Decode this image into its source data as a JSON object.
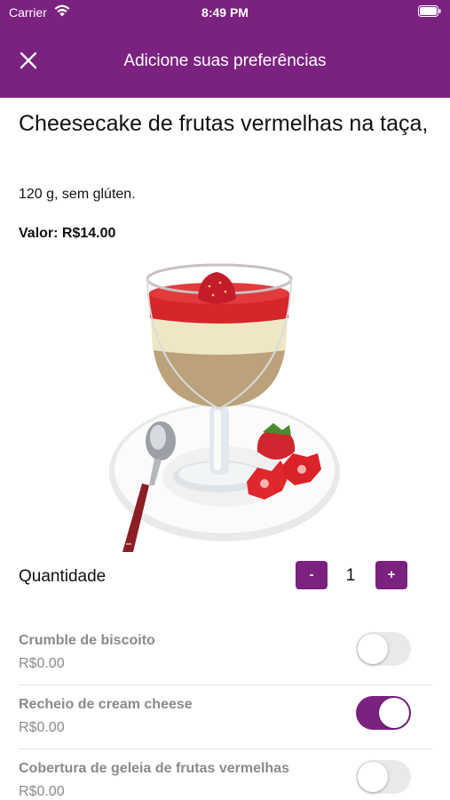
{
  "status_bar": {
    "carrier": "Carrier",
    "time": "8:49 PM"
  },
  "appbar": {
    "title": "Adicione suas preferências",
    "background": "#7b2180"
  },
  "product": {
    "title": "Cheesecake de frutas vermelhas na taça,",
    "description": "120 g, sem glúten.",
    "price_label": "Valor:",
    "price_value": "R$14.00"
  },
  "quantity": {
    "label": "Quantidade",
    "minus_label": "-",
    "value": "1",
    "plus_label": "+"
  },
  "options": [
    {
      "name": "Crumble de biscoito",
      "price": "R$0.00",
      "enabled": false
    },
    {
      "name": "Recheio de cream cheese",
      "price": "R$0.00",
      "enabled": true
    },
    {
      "name": "Cobertura de geleia de frutas vermelhas",
      "price": "R$0.00",
      "enabled": false
    }
  ]
}
